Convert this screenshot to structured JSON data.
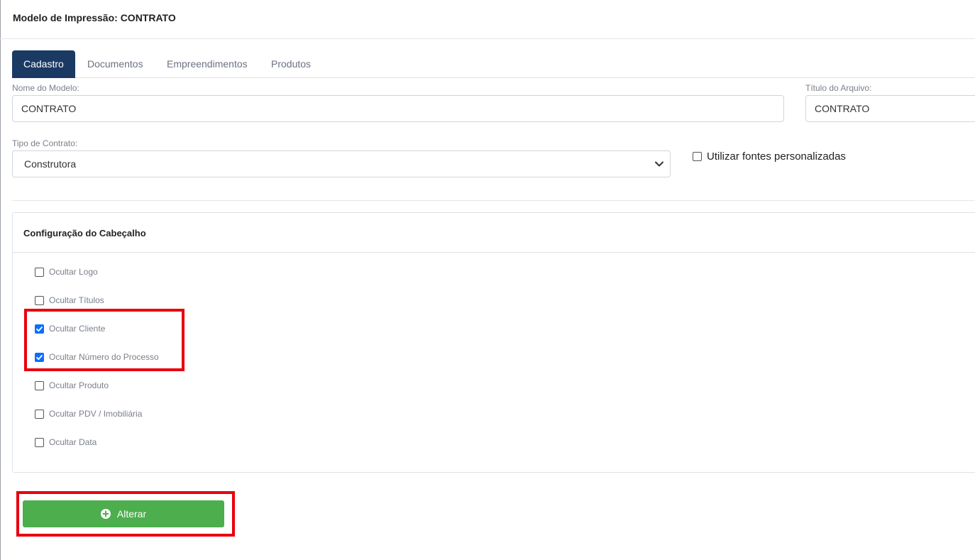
{
  "page": {
    "title": "Modelo de Impressão: CONTRATO"
  },
  "tabs": [
    {
      "label": "Cadastro",
      "active": true
    },
    {
      "label": "Documentos",
      "active": false
    },
    {
      "label": "Empreendimentos",
      "active": false
    },
    {
      "label": "Produtos",
      "active": false
    }
  ],
  "form": {
    "nome_label": "Nome do Modelo:",
    "nome_value": "CONTRATO",
    "titulo_label": "Título do Arquivo:",
    "titulo_value": "CONTRATO",
    "tipo_label": "Tipo de Contrato:",
    "tipo_value": "Construtora",
    "fontes_label": "Utilizar fontes personalizadas",
    "fontes_checked": false
  },
  "header_config": {
    "title": "Configuração do Cabeçalho",
    "options": [
      {
        "label": "Ocultar Logo",
        "checked": false
      },
      {
        "label": "Ocultar Títulos",
        "checked": false
      },
      {
        "label": "Ocultar Cliente",
        "checked": true
      },
      {
        "label": "Ocultar Número do Processo",
        "checked": true
      },
      {
        "label": "Ocultar Produto",
        "checked": false
      },
      {
        "label": "Ocultar PDV / Imobiliária",
        "checked": false
      },
      {
        "label": "Ocultar Data",
        "checked": false
      }
    ]
  },
  "actions": {
    "alterar_label": "Alterar",
    "icon": "plus-circle-icon"
  },
  "colors": {
    "primary_tab": "#1b3a63",
    "success": "#4cae4c",
    "highlight": "#e8000b",
    "checkbox": "#0d6efd"
  }
}
